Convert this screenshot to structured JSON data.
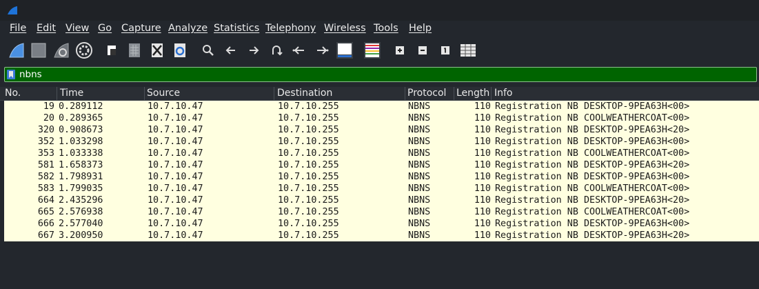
{
  "app": {
    "logo_icon": "wireshark-fin-icon"
  },
  "menu": [
    "File",
    "Edit",
    "View",
    "Go",
    "Capture",
    "Analyze",
    "Statistics",
    "Telephony",
    "Wireless",
    "Tools",
    "Help"
  ],
  "toolbar": {
    "icons": [
      "start-capture-icon",
      "stop-capture-icon",
      "restart-capture-icon",
      "capture-options-icon",
      "open-file-icon",
      "save-file-icon",
      "close-file-icon",
      "reload-file-icon",
      "find-packet-icon",
      "go-back-icon",
      "go-forward-icon",
      "go-to-packet-icon",
      "go-first-packet-icon",
      "go-last-packet-icon",
      "auto-scroll-icon",
      "colorize-icon",
      "zoom-in-icon",
      "zoom-out-icon",
      "normal-size-icon",
      "resize-columns-icon"
    ]
  },
  "filter": {
    "value": "nbns",
    "background": "#006400"
  },
  "columns": [
    "No.",
    "Time",
    "Source",
    "Destination",
    "Protocol",
    "Length",
    "Info"
  ],
  "rows": [
    {
      "no": "19",
      "time": "0.289112",
      "src": "10.7.10.47",
      "dst": "10.7.10.255",
      "proto": "NBNS",
      "len": "110",
      "info": "Registration NB DESKTOP-9PEA63H<00>"
    },
    {
      "no": "20",
      "time": "0.289365",
      "src": "10.7.10.47",
      "dst": "10.7.10.255",
      "proto": "NBNS",
      "len": "110",
      "info": "Registration NB COOLWEATHERCOAT<00>"
    },
    {
      "no": "320",
      "time": "0.908673",
      "src": "10.7.10.47",
      "dst": "10.7.10.255",
      "proto": "NBNS",
      "len": "110",
      "info": "Registration NB DESKTOP-9PEA63H<20>"
    },
    {
      "no": "352",
      "time": "1.033298",
      "src": "10.7.10.47",
      "dst": "10.7.10.255",
      "proto": "NBNS",
      "len": "110",
      "info": "Registration NB DESKTOP-9PEA63H<00>"
    },
    {
      "no": "353",
      "time": "1.033338",
      "src": "10.7.10.47",
      "dst": "10.7.10.255",
      "proto": "NBNS",
      "len": "110",
      "info": "Registration NB COOLWEATHERCOAT<00>"
    },
    {
      "no": "581",
      "time": "1.658373",
      "src": "10.7.10.47",
      "dst": "10.7.10.255",
      "proto": "NBNS",
      "len": "110",
      "info": "Registration NB DESKTOP-9PEA63H<20>"
    },
    {
      "no": "582",
      "time": "1.798931",
      "src": "10.7.10.47",
      "dst": "10.7.10.255",
      "proto": "NBNS",
      "len": "110",
      "info": "Registration NB DESKTOP-9PEA63H<00>"
    },
    {
      "no": "583",
      "time": "1.799035",
      "src": "10.7.10.47",
      "dst": "10.7.10.255",
      "proto": "NBNS",
      "len": "110",
      "info": "Registration NB COOLWEATHERCOAT<00>"
    },
    {
      "no": "664",
      "time": "2.435296",
      "src": "10.7.10.47",
      "dst": "10.7.10.255",
      "proto": "NBNS",
      "len": "110",
      "info": "Registration NB DESKTOP-9PEA63H<20>"
    },
    {
      "no": "665",
      "time": "2.576938",
      "src": "10.7.10.47",
      "dst": "10.7.10.255",
      "proto": "NBNS",
      "len": "110",
      "info": "Registration NB COOLWEATHERCOAT<00>"
    },
    {
      "no": "666",
      "time": "2.577040",
      "src": "10.7.10.47",
      "dst": "10.7.10.255",
      "proto": "NBNS",
      "len": "110",
      "info": "Registration NB DESKTOP-9PEA63H<00>"
    },
    {
      "no": "667",
      "time": "3.200950",
      "src": "10.7.10.47",
      "dst": "10.7.10.255",
      "proto": "NBNS",
      "len": "110",
      "info": "Registration NB DESKTOP-9PEA63H<20>"
    }
  ],
  "colors": {
    "row_background": "#ffffe0",
    "window_background": "#23272d"
  }
}
